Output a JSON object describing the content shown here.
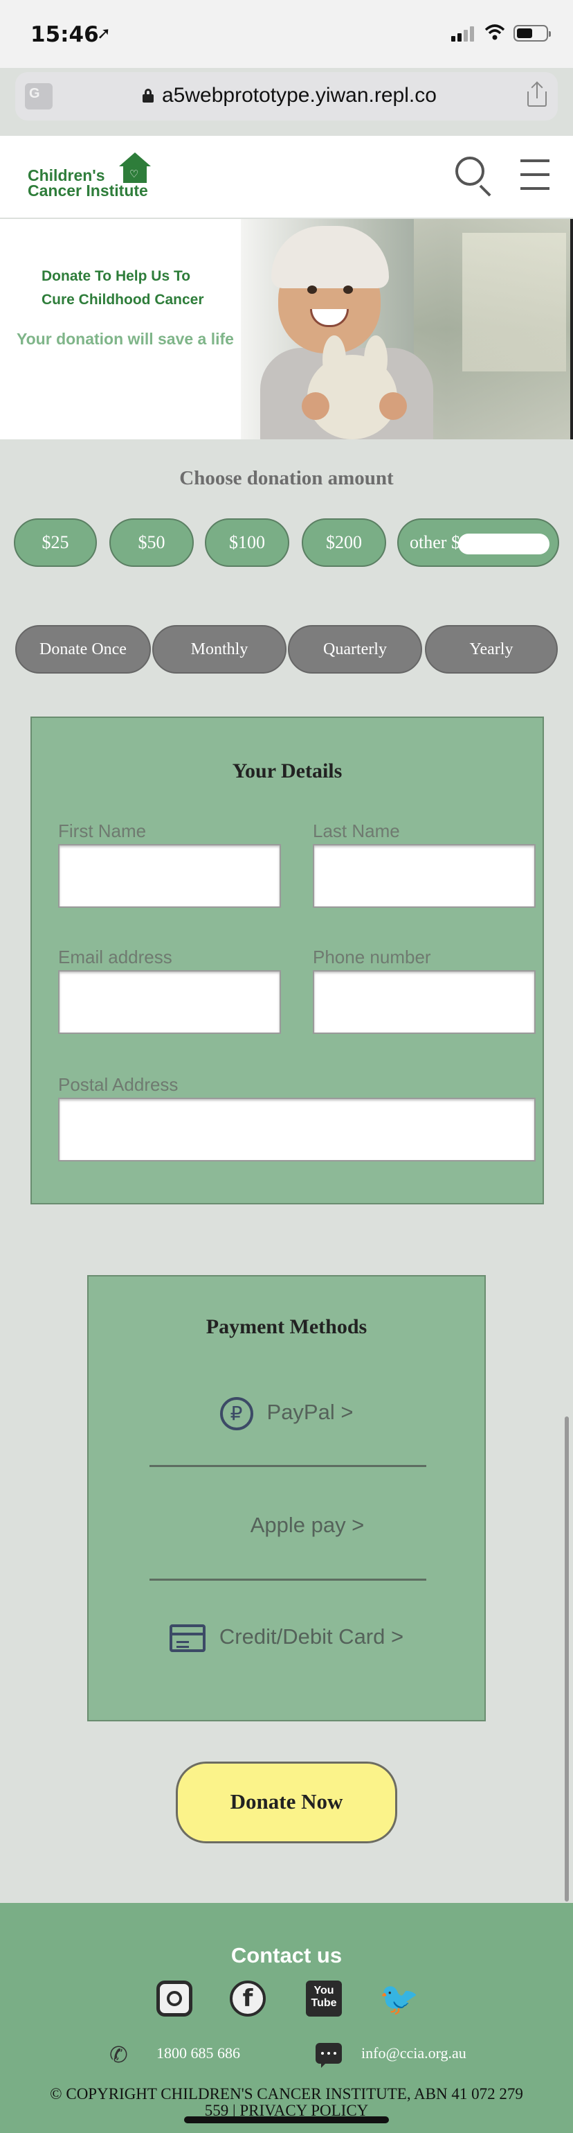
{
  "status_bar": {
    "time": "15:46",
    "location_icon": "location-arrow-icon"
  },
  "browser": {
    "url": "a5webprototype.yiwan.repl.co"
  },
  "header": {
    "logo_line1": "Children's",
    "logo_line2": "Cancer Institute"
  },
  "hero": {
    "headline_line1": "Donate To Help Us To",
    "headline_line2": "Cure Childhood Cancer",
    "tagline": "Your donation will save a life"
  },
  "donation": {
    "title": "Choose donation amount",
    "amounts": [
      "$25",
      "$50",
      "$100",
      "$200"
    ],
    "other_label": "other $",
    "other_value": "",
    "frequencies": [
      "Donate Once",
      "Monthly",
      "Quarterly",
      "Yearly"
    ]
  },
  "details": {
    "title": "Your Details",
    "first_name_label": "First Name",
    "last_name_label": "Last Name",
    "email_label": "Email address",
    "phone_label": "Phone number",
    "postal_label": "Postal Address"
  },
  "payment": {
    "title": "Payment Methods",
    "paypal": "PayPal  >",
    "apple": "Apple pay  >",
    "card": "Credit/Debit Card  >"
  },
  "donate_button": "Donate Now",
  "footer": {
    "title": "Contact us",
    "phone": "1800 685 686",
    "email": "info@ccia.org.au",
    "copyright_line1": "© COPYRIGHT CHILDREN'S CANCER INSTITUTE, ABN 41 072 279",
    "copyright_line2": "559 | PRIVACY POLICY"
  },
  "colors": {
    "accent_green": "#7aae86",
    "card_green": "#8db997",
    "brand_green": "#2e7d3a",
    "frequency_gray": "#7d7d7d",
    "donate_yellow": "#fbf38a"
  }
}
